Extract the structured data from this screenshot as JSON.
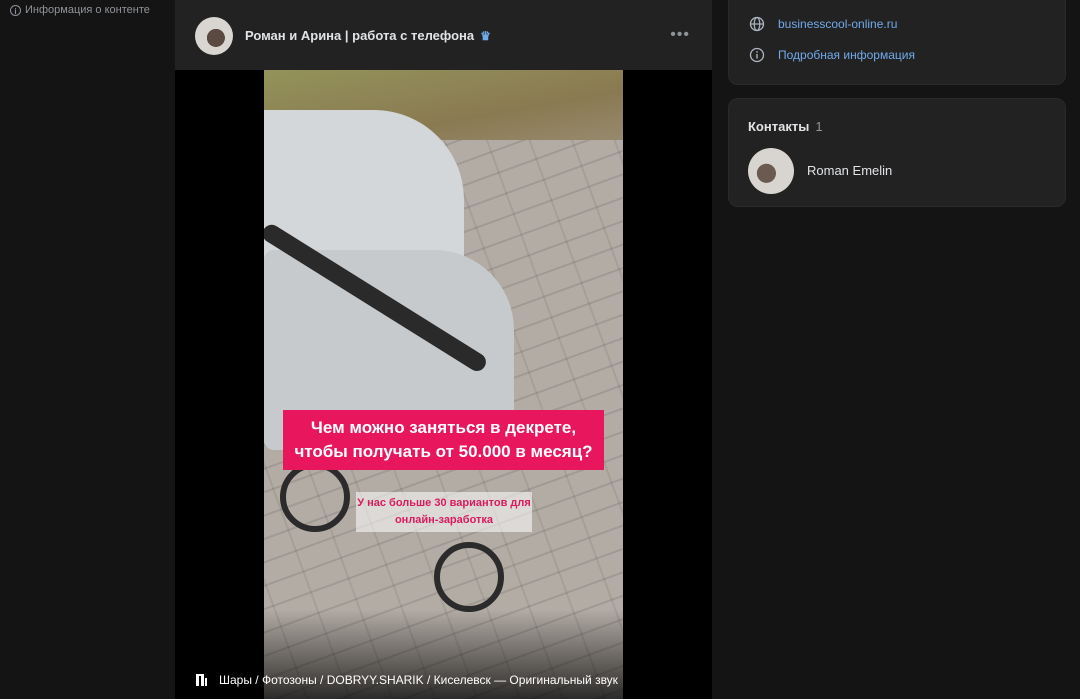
{
  "left_panel": {
    "content_info_label": "Информация о контенте"
  },
  "post": {
    "author": "Роман и Арина | работа с телефона",
    "verified_icon": "crown-icon",
    "menu_icon": "more-dots-icon",
    "video": {
      "overlay_title": "Чем можно заняться в декрете, чтобы получать от 50.000 в месяц?",
      "overlay_subtitle": "У нас больше 30 вариантов для онлайн-заработка",
      "audio_icon": "music-note-icon",
      "audio_track": "Шары / Фотозоны / DOBRYY.SHARIK / Киселевск — Оригинальный звук"
    }
  },
  "sidebar": {
    "links": [
      {
        "icon": "globe-icon",
        "text": "businesscool-online.ru"
      },
      {
        "icon": "info-icon",
        "text": "Подробная информация"
      }
    ],
    "contacts": {
      "title": "Контакты",
      "count": "1",
      "items": [
        {
          "name": "Roman Emelin"
        }
      ]
    }
  },
  "colors": {
    "accent_link": "#71aaeb",
    "overlay_pink": "#e8175d",
    "background": "#141414",
    "card": "#222222"
  }
}
